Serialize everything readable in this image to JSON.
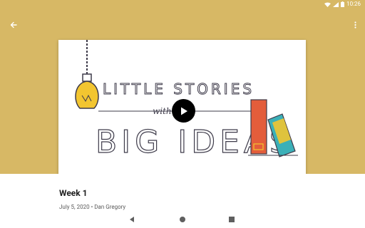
{
  "status": {
    "time": "10:26"
  },
  "colors": {
    "appbar": "#d7b865",
    "book_red": "#e35d3b",
    "book_teal": "#3bb0b8",
    "bulb": "#f2c530",
    "ink": "#3e3b4a"
  },
  "toolbar": {
    "back_icon": "arrow-back-icon",
    "more_icon": "more-vert-icon"
  },
  "thumbnail": {
    "line1": "LITTLE STORIES",
    "line2": "with",
    "line3": "BIG IDEAS"
  },
  "post": {
    "title": "Week 1",
    "meta": "July 5, 2020 • Dan Gregory"
  },
  "navigation": {
    "back_icon": "nav-back-icon",
    "home_icon": "nav-home-icon",
    "recents_icon": "nav-recents-icon"
  }
}
